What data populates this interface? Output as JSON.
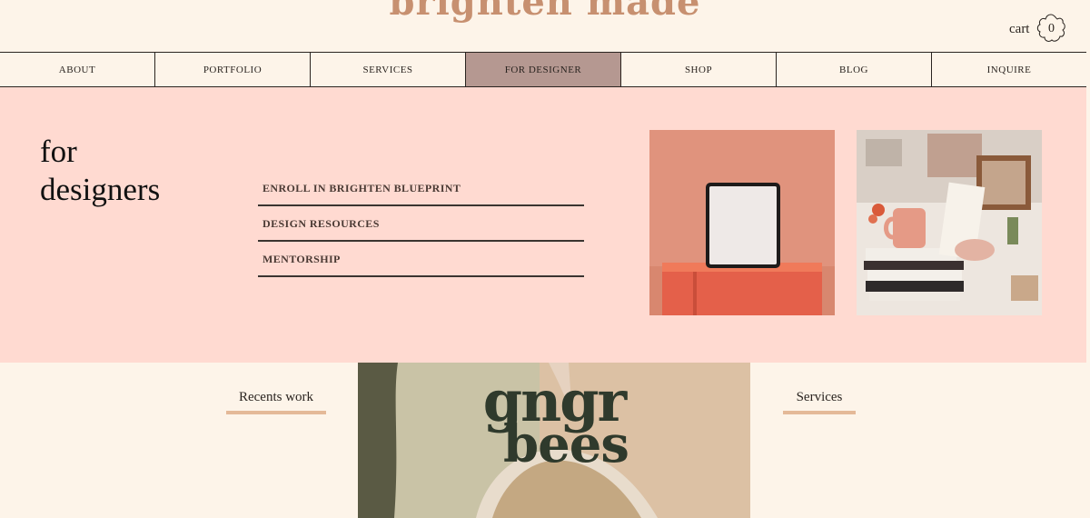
{
  "header": {
    "logo": "brighten made",
    "cart_label": "cart",
    "cart_count": "0"
  },
  "nav": {
    "items": [
      "ABOUT",
      "PORTFOLIO",
      "SERVICES",
      "FOR DESIGNER",
      "SHOP",
      "BLOG",
      "INQUIRE"
    ],
    "active": "FOR DESIGNER"
  },
  "hero": {
    "title_line1": "for",
    "title_line2": "designers",
    "links": [
      "ENROLL IN BRIGHTEN BLUEPRINT",
      "DESIGN RESOURCES",
      "MENTORSHIP"
    ]
  },
  "lower": {
    "recent_work": "Recents work",
    "services": "Services",
    "banner_line1": "gngr",
    "banner_line2": "bees"
  },
  "colors": {
    "background": "#fdf4e9",
    "hero_pink": "#ffdad1",
    "nav_active": "#b59891",
    "logo": "#c79070",
    "underline_accent": "#e4b998",
    "banner_text": "#2f3a2c"
  }
}
